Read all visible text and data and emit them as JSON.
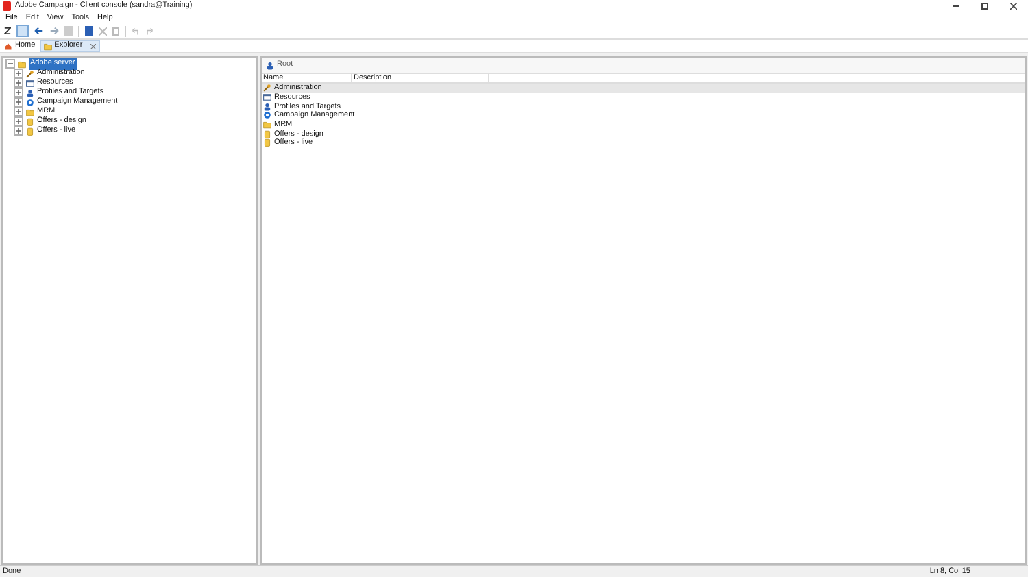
{
  "window": {
    "title": "Adobe Campaign - Client console (sandra@Training)"
  },
  "menu": [
    "File",
    "Edit",
    "View",
    "Tools",
    "Help"
  ],
  "tabs": [
    {
      "label": "Home",
      "selected": false,
      "kind": "home"
    },
    {
      "label": "Explorer",
      "selected": true,
      "kind": "folder"
    }
  ],
  "tree": {
    "root": {
      "label": "Adobe server",
      "selected": true,
      "expanded": true,
      "children": [
        {
          "label": "Administration",
          "kind": "wrench",
          "expanded": false
        },
        {
          "label": "Resources",
          "kind": "resources",
          "expanded": false
        },
        {
          "label": "Profiles and Targets",
          "kind": "people",
          "expanded": false
        },
        {
          "label": "Campaign Management",
          "kind": "gear",
          "expanded": false
        },
        {
          "label": "MRM",
          "kind": "folder",
          "expanded": false
        },
        {
          "label": "Offers - design",
          "kind": "offer",
          "expanded": false
        },
        {
          "label": "Offers - live",
          "kind": "offer",
          "expanded": false
        }
      ]
    }
  },
  "list": {
    "toolbar_button": "Root",
    "columns": [
      "Name",
      "Description"
    ],
    "rows": [
      {
        "name": "Administration",
        "kind": "wrench",
        "selected": true
      },
      {
        "name": "Resources",
        "kind": "resources",
        "selected": false
      },
      {
        "name": "Profiles and Targets",
        "kind": "people",
        "selected": false
      },
      {
        "name": "Campaign Management",
        "kind": "gear",
        "selected": false
      },
      {
        "name": "MRM",
        "kind": "folder",
        "selected": false
      },
      {
        "name": "Offers - design",
        "kind": "offer",
        "selected": false
      },
      {
        "name": "Offers - live",
        "kind": "offer",
        "selected": false
      }
    ]
  },
  "status_bar": {
    "left": "Done",
    "position": "Ln 8, Col 15"
  }
}
